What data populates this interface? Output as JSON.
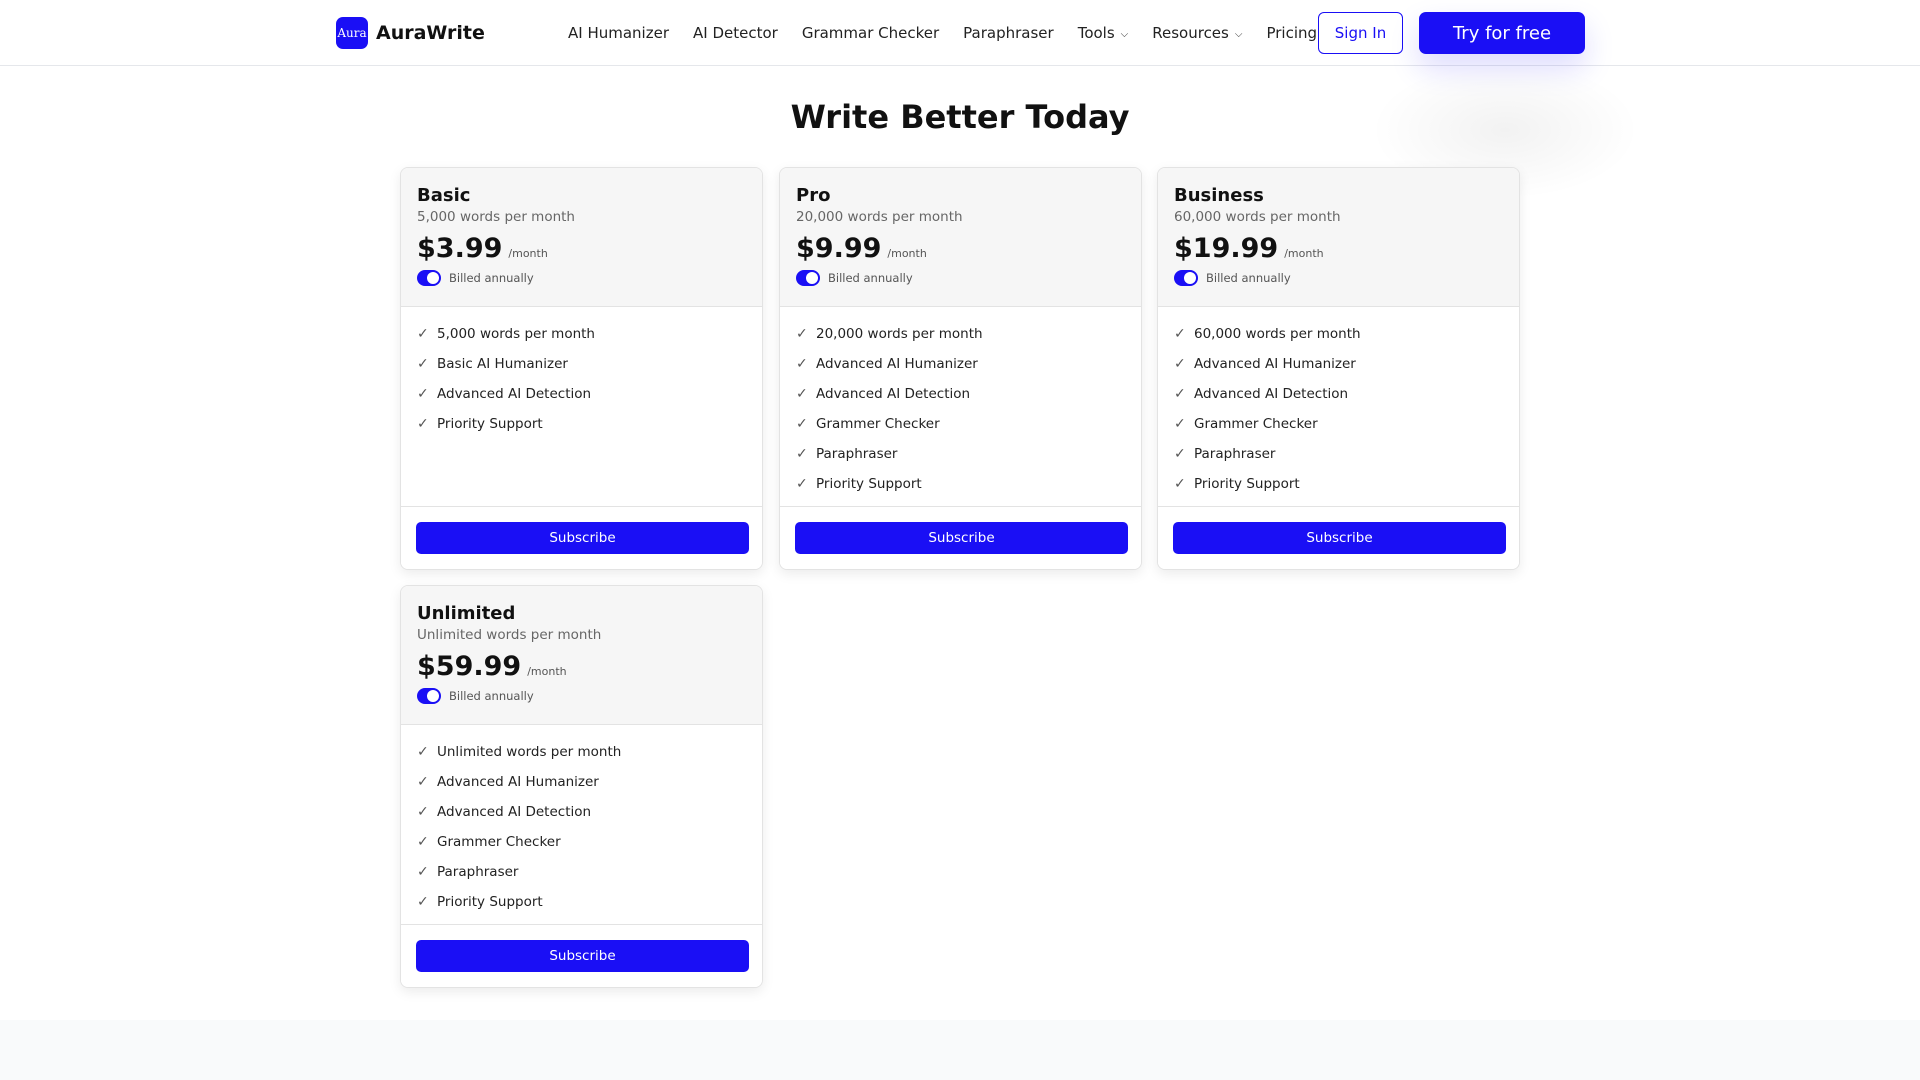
{
  "brand": {
    "logo_mark": "Aura",
    "name": "AuraWrite",
    "accent": "#1a0ff5"
  },
  "nav": {
    "items": [
      {
        "label": "AI Humanizer"
      },
      {
        "label": "AI Detector"
      },
      {
        "label": "Grammar Checker"
      },
      {
        "label": "Paraphraser"
      },
      {
        "label": "Tools",
        "dropdown": true
      },
      {
        "label": "Resources",
        "dropdown": true
      },
      {
        "label": "Pricing"
      }
    ],
    "sign_in": "Sign In",
    "try_free": "Try for free"
  },
  "page": {
    "title": "Write Better Today"
  },
  "plans": [
    {
      "name": "Basic",
      "words": "5,000 words per month",
      "price": "$3.99",
      "per": "/month",
      "billed": "Billed annually",
      "billed_on": true,
      "features": [
        "5,000 words per month",
        "Basic AI Humanizer",
        "Advanced AI Detection",
        "Priority Support"
      ],
      "cta": "Subscribe"
    },
    {
      "name": "Pro",
      "words": "20,000 words per month",
      "price": "$9.99",
      "per": "/month",
      "billed": "Billed annually",
      "billed_on": true,
      "features": [
        "20,000 words per month",
        "Advanced AI Humanizer",
        "Advanced AI Detection",
        "Grammer Checker",
        "Paraphraser",
        "Priority Support"
      ],
      "cta": "Subscribe"
    },
    {
      "name": "Business",
      "words": "60,000 words per month",
      "price": "$19.99",
      "per": "/month",
      "billed": "Billed annually",
      "billed_on": true,
      "features": [
        "60,000 words per month",
        "Advanced AI Humanizer",
        "Advanced AI Detection",
        "Grammer Checker",
        "Paraphraser",
        "Priority Support"
      ],
      "cta": "Subscribe"
    },
    {
      "name": "Unlimited",
      "words": "Unlimited words per month",
      "price": "$59.99",
      "per": "/month",
      "billed": "Billed annually",
      "billed_on": true,
      "features": [
        "Unlimited words per month",
        "Advanced AI Humanizer",
        "Advanced AI Detection",
        "Grammer Checker",
        "Paraphraser",
        "Priority Support"
      ],
      "cta": "Subscribe"
    }
  ],
  "icons": {
    "check": "check-icon",
    "chevron": "chevron-down-icon"
  }
}
